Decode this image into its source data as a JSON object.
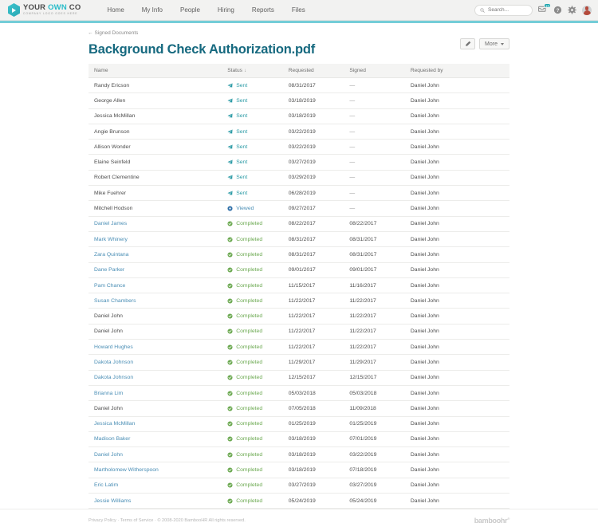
{
  "header": {
    "logo": {
      "title_part1": "YOUR ",
      "title_accent": "OWN",
      "title_part2": " CO",
      "subtitle": "COMPANY LOGO GOES HERE"
    },
    "nav": [
      {
        "label": "Home"
      },
      {
        "label": "My Info"
      },
      {
        "label": "People"
      },
      {
        "label": "Hiring"
      },
      {
        "label": "Reports"
      },
      {
        "label": "Files"
      }
    ],
    "search": {
      "placeholder": "Search...",
      "value": ""
    },
    "inbox_badge": "10",
    "icons": [
      "inbox-icon",
      "help-icon",
      "gear-icon",
      "avatar"
    ]
  },
  "breadcrumb": {
    "arrow": "←",
    "label": "Signed Documents"
  },
  "page_title": "Background Check Authorization.pdf",
  "actions": {
    "edit_label": "",
    "more_label": "More"
  },
  "table": {
    "columns": [
      "Name",
      "Status",
      "Requested",
      "Signed",
      "Requested by"
    ],
    "sorted_column": "Status",
    "sort_arrow": "↓",
    "rows": [
      {
        "name": "Randy Ericson",
        "is_link": false,
        "status": "Sent",
        "status_type": "sent",
        "requested": "08/31/2017",
        "signed": "—",
        "requested_by": "Daniel John"
      },
      {
        "name": "George Allen",
        "is_link": false,
        "status": "Sent",
        "status_type": "sent",
        "requested": "03/18/2019",
        "signed": "—",
        "requested_by": "Daniel John"
      },
      {
        "name": "Jessica McMillan",
        "is_link": false,
        "status": "Sent",
        "status_type": "sent",
        "requested": "03/18/2019",
        "signed": "—",
        "requested_by": "Daniel John"
      },
      {
        "name": "Angie Brunson",
        "is_link": false,
        "status": "Sent",
        "status_type": "sent",
        "requested": "03/22/2019",
        "signed": "—",
        "requested_by": "Daniel John"
      },
      {
        "name": "Allison Wonder",
        "is_link": false,
        "status": "Sent",
        "status_type": "sent",
        "requested": "03/22/2019",
        "signed": "—",
        "requested_by": "Daniel John"
      },
      {
        "name": "Elaine Seinfeld",
        "is_link": false,
        "status": "Sent",
        "status_type": "sent",
        "requested": "03/27/2019",
        "signed": "—",
        "requested_by": "Daniel John"
      },
      {
        "name": "Robert Clementine",
        "is_link": false,
        "status": "Sent",
        "status_type": "sent",
        "requested": "03/29/2019",
        "signed": "—",
        "requested_by": "Daniel John"
      },
      {
        "name": "Mike Fuehrer",
        "is_link": false,
        "status": "Sent",
        "status_type": "sent",
        "requested": "06/28/2019",
        "signed": "—",
        "requested_by": "Daniel John"
      },
      {
        "name": "Mitchell Hodson",
        "is_link": false,
        "status": "Viewed",
        "status_type": "viewed",
        "requested": "09/27/2017",
        "signed": "—",
        "requested_by": "Daniel John"
      },
      {
        "name": "Daniel James",
        "is_link": true,
        "status": "Completed",
        "status_type": "completed",
        "requested": "08/22/2017",
        "signed": "08/22/2017",
        "requested_by": "Daniel John"
      },
      {
        "name": "Mark Whinery",
        "is_link": true,
        "status": "Completed",
        "status_type": "completed",
        "requested": "08/31/2017",
        "signed": "08/31/2017",
        "requested_by": "Daniel John"
      },
      {
        "name": "Zara Quintana",
        "is_link": true,
        "status": "Completed",
        "status_type": "completed",
        "requested": "08/31/2017",
        "signed": "08/31/2017",
        "requested_by": "Daniel John"
      },
      {
        "name": "Dane Parker",
        "is_link": true,
        "status": "Completed",
        "status_type": "completed",
        "requested": "09/01/2017",
        "signed": "09/01/2017",
        "requested_by": "Daniel John"
      },
      {
        "name": "Pam Chance",
        "is_link": true,
        "status": "Completed",
        "status_type": "completed",
        "requested": "11/15/2017",
        "signed": "11/16/2017",
        "requested_by": "Daniel John"
      },
      {
        "name": "Susan Chambers",
        "is_link": true,
        "status": "Completed",
        "status_type": "completed",
        "requested": "11/22/2017",
        "signed": "11/22/2017",
        "requested_by": "Daniel John"
      },
      {
        "name": "Daniel John",
        "is_link": false,
        "status": "Completed",
        "status_type": "completed",
        "requested": "11/22/2017",
        "signed": "11/22/2017",
        "requested_by": "Daniel John"
      },
      {
        "name": "Daniel John",
        "is_link": false,
        "status": "Completed",
        "status_type": "completed",
        "requested": "11/22/2017",
        "signed": "11/22/2017",
        "requested_by": "Daniel John"
      },
      {
        "name": "Howard Hughes",
        "is_link": true,
        "status": "Completed",
        "status_type": "completed",
        "requested": "11/22/2017",
        "signed": "11/22/2017",
        "requested_by": "Daniel John"
      },
      {
        "name": "Dakota Johnson",
        "is_link": true,
        "status": "Completed",
        "status_type": "completed",
        "requested": "11/29/2017",
        "signed": "11/29/2017",
        "requested_by": "Daniel John"
      },
      {
        "name": "Dakota Johnson",
        "is_link": true,
        "status": "Completed",
        "status_type": "completed",
        "requested": "12/15/2017",
        "signed": "12/15/2017",
        "requested_by": "Daniel John"
      },
      {
        "name": "Brianna Lim",
        "is_link": true,
        "status": "Completed",
        "status_type": "completed",
        "requested": "05/03/2018",
        "signed": "05/03/2018",
        "requested_by": "Daniel John"
      },
      {
        "name": "Daniel John",
        "is_link": false,
        "status": "Completed",
        "status_type": "completed",
        "requested": "07/05/2018",
        "signed": "11/09/2018",
        "requested_by": "Daniel John"
      },
      {
        "name": "Jessica McMillan",
        "is_link": true,
        "status": "Completed",
        "status_type": "completed",
        "requested": "01/25/2019",
        "signed": "01/25/2019",
        "requested_by": "Daniel John"
      },
      {
        "name": "Madison Baker",
        "is_link": true,
        "status": "Completed",
        "status_type": "completed",
        "requested": "03/18/2019",
        "signed": "07/01/2019",
        "requested_by": "Daniel John"
      },
      {
        "name": "Daniel John",
        "is_link": true,
        "status": "Completed",
        "status_type": "completed",
        "requested": "03/18/2019",
        "signed": "03/22/2019",
        "requested_by": "Daniel John"
      },
      {
        "name": "Martholomew Witherspoon",
        "is_link": true,
        "status": "Completed",
        "status_type": "completed",
        "requested": "03/18/2019",
        "signed": "07/18/2019",
        "requested_by": "Daniel John"
      },
      {
        "name": "Eric Latim",
        "is_link": true,
        "status": "Completed",
        "status_type": "completed",
        "requested": "03/27/2019",
        "signed": "03/27/2019",
        "requested_by": "Daniel John"
      },
      {
        "name": "Jessie Williams",
        "is_link": true,
        "status": "Completed",
        "status_type": "completed",
        "requested": "05/24/2019",
        "signed": "05/24/2019",
        "requested_by": "Daniel John"
      }
    ]
  },
  "footer": {
    "privacy": "Privacy Policy",
    "sep1": "·",
    "terms": "Terms of Service",
    "sep2": "·",
    "copyright": "© 2008-2020 BambooHR All rights reserved.",
    "logo": "bamboohr"
  },
  "colors": {
    "accent_teal": "#74cdd8",
    "title_teal": "#16697f",
    "link_blue": "#4a8eb5",
    "status_sent": "#2a9aa5",
    "status_viewed": "#2f6fa8",
    "status_completed": "#6aa84f"
  }
}
